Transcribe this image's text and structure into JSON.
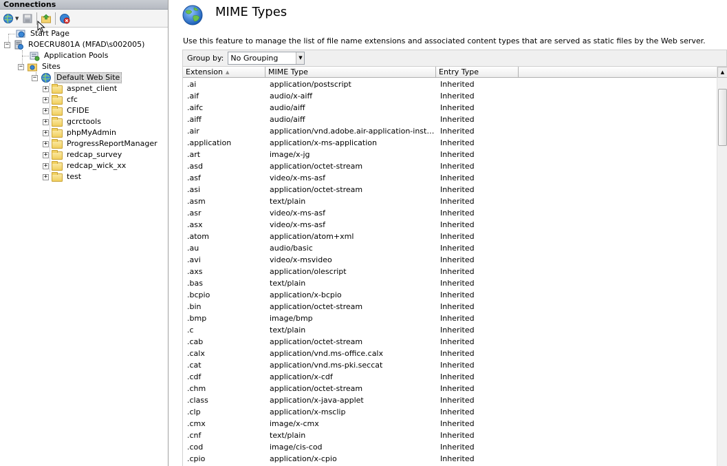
{
  "connections": {
    "header": "Connections",
    "toolbar": {
      "icons": [
        "connect-globe-icon",
        "save-icon",
        "up-folder-icon",
        "disconnect-icon"
      ]
    },
    "tree": {
      "start_page": "Start Page",
      "server": "ROECRU801A (MFAD\\s002005)",
      "app_pools": "Application Pools",
      "sites": "Sites",
      "default_site": "Default Web Site",
      "folders": [
        "aspnet_client",
        "cfc",
        "CFIDE",
        "gcrctools",
        "phpMyAdmin",
        "ProgressReportManager",
        "redcap_survey",
        "redcap_wick_xx",
        "test"
      ]
    }
  },
  "main": {
    "title": "MIME Types",
    "description": "Use this feature to manage the list of file name extensions and associated content types that are served as static files by the Web server.",
    "group_by_label": "Group by:",
    "group_by_value": "No Grouping",
    "columns": {
      "extension": "Extension",
      "mime_type": "MIME Type",
      "entry_type": "Entry Type"
    },
    "rows": [
      [
        ".ai",
        "application/postscript",
        "Inherited"
      ],
      [
        ".aif",
        "audio/x-aiff",
        "Inherited"
      ],
      [
        ".aifc",
        "audio/aiff",
        "Inherited"
      ],
      [
        ".aiff",
        "audio/aiff",
        "Inherited"
      ],
      [
        ".air",
        "application/vnd.adobe.air-application-installer-...",
        "Inherited"
      ],
      [
        ".application",
        "application/x-ms-application",
        "Inherited"
      ],
      [
        ".art",
        "image/x-jg",
        "Inherited"
      ],
      [
        ".asd",
        "application/octet-stream",
        "Inherited"
      ],
      [
        ".asf",
        "video/x-ms-asf",
        "Inherited"
      ],
      [
        ".asi",
        "application/octet-stream",
        "Inherited"
      ],
      [
        ".asm",
        "text/plain",
        "Inherited"
      ],
      [
        ".asr",
        "video/x-ms-asf",
        "Inherited"
      ],
      [
        ".asx",
        "video/x-ms-asf",
        "Inherited"
      ],
      [
        ".atom",
        "application/atom+xml",
        "Inherited"
      ],
      [
        ".au",
        "audio/basic",
        "Inherited"
      ],
      [
        ".avi",
        "video/x-msvideo",
        "Inherited"
      ],
      [
        ".axs",
        "application/olescript",
        "Inherited"
      ],
      [
        ".bas",
        "text/plain",
        "Inherited"
      ],
      [
        ".bcpio",
        "application/x-bcpio",
        "Inherited"
      ],
      [
        ".bin",
        "application/octet-stream",
        "Inherited"
      ],
      [
        ".bmp",
        "image/bmp",
        "Inherited"
      ],
      [
        ".c",
        "text/plain",
        "Inherited"
      ],
      [
        ".cab",
        "application/octet-stream",
        "Inherited"
      ],
      [
        ".calx",
        "application/vnd.ms-office.calx",
        "Inherited"
      ],
      [
        ".cat",
        "application/vnd.ms-pki.seccat",
        "Inherited"
      ],
      [
        ".cdf",
        "application/x-cdf",
        "Inherited"
      ],
      [
        ".chm",
        "application/octet-stream",
        "Inherited"
      ],
      [
        ".class",
        "application/x-java-applet",
        "Inherited"
      ],
      [
        ".clp",
        "application/x-msclip",
        "Inherited"
      ],
      [
        ".cmx",
        "image/x-cmx",
        "Inherited"
      ],
      [
        ".cnf",
        "text/plain",
        "Inherited"
      ],
      [
        ".cod",
        "image/cis-cod",
        "Inherited"
      ],
      [
        ".cpio",
        "application/x-cpio",
        "Inherited"
      ]
    ]
  }
}
